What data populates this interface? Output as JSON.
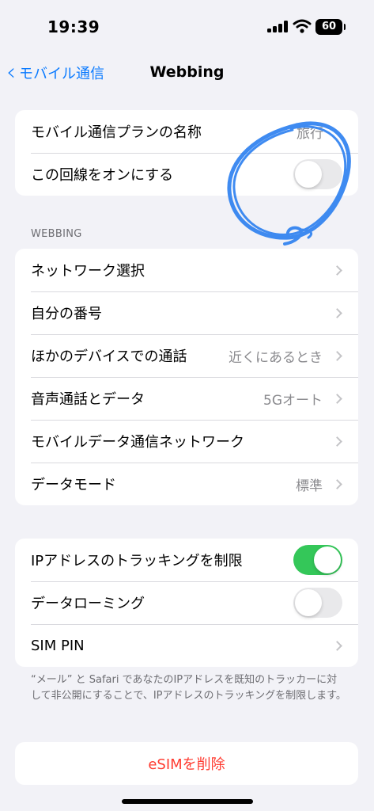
{
  "status_bar": {
    "time": "19:39",
    "battery": "60"
  },
  "nav": {
    "back_label": "モバイル通信",
    "title": "Webbing"
  },
  "group1": {
    "plan_name_label": "モバイル通信プランの名称",
    "plan_name_value": "旅行",
    "line_on_label": "この回線をオンにする",
    "line_on_state": false
  },
  "section_header": "WEBBING",
  "group2": {
    "items": [
      {
        "label": "ネットワーク選択",
        "value": ""
      },
      {
        "label": "自分の番号",
        "value": ""
      },
      {
        "label": "ほかのデバイスでの通話",
        "value": "近くにあるとき"
      },
      {
        "label": "音声通話とデータ",
        "value": "5Gオート"
      },
      {
        "label": "モバイルデータ通信ネットワーク",
        "value": ""
      },
      {
        "label": "データモード",
        "value": "標準"
      }
    ]
  },
  "group3": {
    "ip_limit_label": "IPアドレスのトラッキングを制限",
    "ip_limit_state": true,
    "roaming_label": "データローミング",
    "roaming_state": false,
    "sim_pin_label": "SIM PIN"
  },
  "footer_text": "“メール” と Safari であなたのIPアドレスを既知のトラッカーに対して非公開にすることで、IPアドレスのトラッキングを制限します。",
  "delete_esim_label": "eSIMを削除",
  "colors": {
    "accent": "#0a7aff",
    "toggle_on": "#34c759",
    "destructive": "#ff3b30",
    "annotation": "#2b7ff0"
  },
  "icons": [
    "signal-icon",
    "wifi-icon",
    "battery-icon",
    "chevron-left-icon",
    "chevron-right-icon"
  ]
}
